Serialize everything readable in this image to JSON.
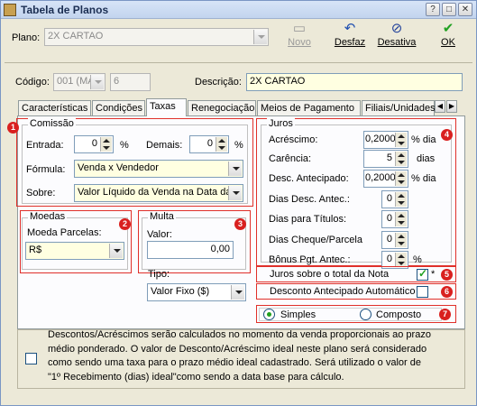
{
  "window": {
    "title": "Tabela de Planos"
  },
  "header": {
    "plano_label": "Plano:",
    "plano_value": "2X CARTAO",
    "codigo_label": "Código:",
    "codigo_combo": "001 (MA",
    "codigo_num": "6",
    "descricao_label": "Descrição:",
    "descricao_value": "2X CARTAO"
  },
  "toolbar": {
    "novo": "Novo",
    "desfaz": "Desfaz",
    "desativa": "Desativa",
    "ok": "OK"
  },
  "tabs": [
    {
      "label": "Características"
    },
    {
      "label": "Condições"
    },
    {
      "label": "Taxas"
    },
    {
      "label": "Renegociação"
    },
    {
      "label": "Meios de Pagamento"
    },
    {
      "label": "Filiais/Unidades"
    }
  ],
  "comissao": {
    "caption": "Comissão",
    "entrada_label": "Entrada:",
    "entrada_value": "0",
    "percent": "%",
    "demais_label": "Demais:",
    "demais_value": "0",
    "formula_label": "Fórmula:",
    "formula_value": "Venda x Vendedor",
    "sobre_label": "Sobre:",
    "sobre_value": "Valor Líquido da Venda na Data da"
  },
  "moedas": {
    "caption": "Moedas",
    "parcelas_label": "Moeda Parcelas:",
    "parcelas_value": "R$"
  },
  "multa": {
    "caption": "Multa",
    "valor_label": "Valor:",
    "valor_value": "0,00",
    "tipo_label": "Tipo:",
    "tipo_value": "Valor Fixo ($)"
  },
  "juros": {
    "caption": "Juros",
    "rows": [
      {
        "label": "Acréscimo:",
        "value": "0,2000",
        "unit": "% dia"
      },
      {
        "label": "Carência:",
        "value": "5",
        "unit": "dias"
      },
      {
        "label": "Desc. Antecipado:",
        "value": "0,2000",
        "unit": "% dia"
      },
      {
        "label": "Dias Desc. Antec.:",
        "value": "0",
        "unit": ""
      },
      {
        "label": "Dias para Títulos:",
        "value": "0",
        "unit": ""
      },
      {
        "label": "Dias Cheque/Parcela",
        "value": "0",
        "unit": ""
      },
      {
        "label": "Bônus Pgt. Antec.:",
        "value": "0",
        "unit": "%"
      }
    ],
    "juros_total_label": "Juros sobre o total da Nota",
    "asterisk": "*",
    "desc_auto_label": "Desconto Antecipado Automático",
    "simples_label": "Simples",
    "composto_label": "Composto"
  },
  "badges": [
    "1",
    "2",
    "3",
    "4",
    "5",
    "6",
    "7"
  ],
  "footer": {
    "line1": "Descontos/Acréscimos serão calculados no momento da venda proporcionais ao prazo",
    "line2": "médio ponderado. O valor de Desconto/Acréscimo ideal neste plano será considerado",
    "line3": "como sendo uma taxa para o prazo médio ideal cadastrado. Será utilizado o valor de",
    "line4": "\"1º Recebimento (dias) ideal\"como sendo a data base para cálculo."
  },
  "colors": {
    "accent_red": "#d9201f",
    "check_green": "#21a121"
  }
}
